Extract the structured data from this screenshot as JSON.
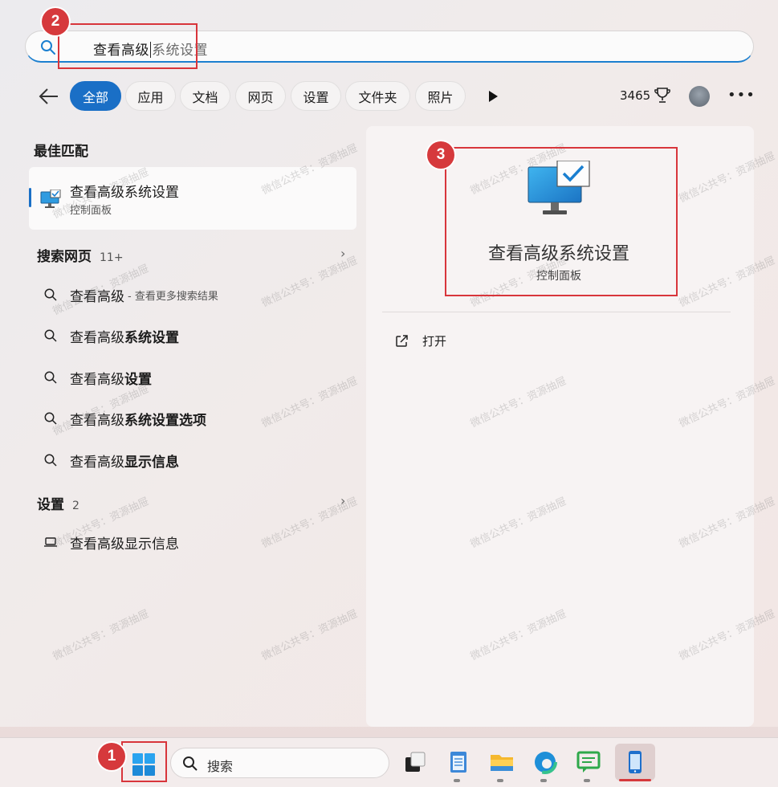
{
  "search": {
    "typed": "查看高级",
    "suggestion": "系统设置"
  },
  "filters": {
    "chips": [
      "全部",
      "应用",
      "文档",
      "网页",
      "设置",
      "文件夹",
      "照片"
    ],
    "points": "3465"
  },
  "best_match": {
    "title": "最佳匹配",
    "item_title": "查看高级系统设置",
    "item_subtitle": "控制面板"
  },
  "web": {
    "title": "搜索网页",
    "count": "11+",
    "items": [
      {
        "plain": "查看高级",
        "bold": "",
        "hint": "- 查看更多搜索结果"
      },
      {
        "plain": "查看高级",
        "bold": "系统设置",
        "hint": ""
      },
      {
        "plain": "查看高级",
        "bold": "设置",
        "hint": ""
      },
      {
        "plain": "查看高级",
        "bold": "系统设置选项",
        "hint": ""
      },
      {
        "plain": "查看高级",
        "bold": "显示信息",
        "hint": ""
      }
    ]
  },
  "settings": {
    "title": "设置",
    "count": "2",
    "item": "查看高级显示信息"
  },
  "preview": {
    "title": "查看高级系统设置",
    "subtitle": "控制面板",
    "action": "打开"
  },
  "annotations": [
    "1",
    "2",
    "3"
  ],
  "watermark": "微信公共号：资源抽屉",
  "taskbar": {
    "search_label": "搜索"
  },
  "colors": {
    "accent": "#1a6fc6",
    "annotation": "#d6393c"
  }
}
